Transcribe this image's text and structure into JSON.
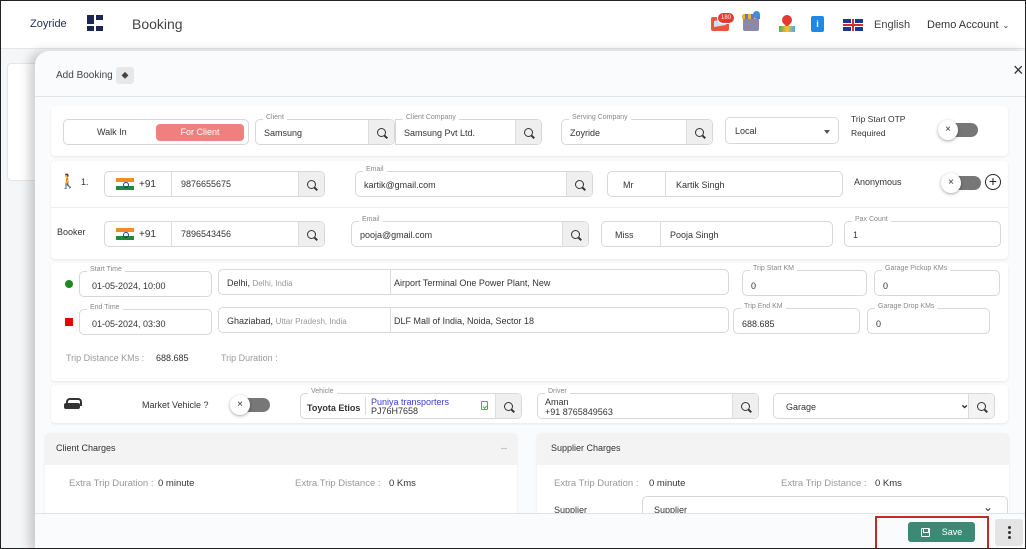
{
  "topbar": {
    "brand": "Zoyride",
    "page_title": "Booking",
    "notification_count": "180",
    "info_glyph": "i",
    "language": "English",
    "account": "Demo Account",
    "chevron": "⌄"
  },
  "modal": {
    "title": "Add Booking",
    "tag_icon": "⬥",
    "close_glyph": "×"
  },
  "booking_type": {
    "options": [
      "Walk In",
      "For Client"
    ],
    "selected": "For Client",
    "client_label": "Client",
    "client_value": "Samsung",
    "client_company_label": "Client Company",
    "client_company_value": "Samsung Pvt Ltd.",
    "serving_company_label": "Serving Company",
    "serving_company_value": "Zoyride",
    "trip_type": "Local",
    "otp_label_1": "Trip Start OTP",
    "otp_label_2": "Required",
    "otp_toggle_glyph": "×"
  },
  "passenger": {
    "index": "1.",
    "country_code": "+91",
    "phone": "9876655675",
    "email_label": "Email",
    "email": "kartik@gmail.com",
    "salutation": "Mr",
    "name": "Kartik Singh",
    "anonymous_label": "Anonymous",
    "toggle_glyph": "×",
    "add_glyph": "+"
  },
  "booker": {
    "label": "Booker",
    "country_code": "+91",
    "phone": "7896543456",
    "email_label": "Email",
    "email": "pooja@gmail.com",
    "salutation": "Miss",
    "name": "Pooja Singh",
    "pax_label": "Pax Count",
    "pax": "1"
  },
  "trip": {
    "start_time_label": "Start Time",
    "start_time": "01-05-2024, 10:00",
    "start_city": "Delhi,",
    "start_region": "Delhi, India",
    "start_address": "Airport Terminal One Power Plant, New",
    "trip_start_km_label": "Trip Start KM",
    "trip_start_km": "0",
    "garage_pickup_label": "Garage Pickup KMs",
    "garage_pickup": "0",
    "end_time_label": "End Time",
    "end_time": "01-05-2024, 03:30",
    "end_city": "Ghaziabad,",
    "end_region": "Uttar Pradesh, India",
    "end_address": "DLF Mall of India, Noida, Sector 18",
    "trip_end_km_label": "Trip End KM",
    "trip_end_km": "688.685",
    "garage_drop_label": "Garage Drop KMs",
    "garage_drop": "0",
    "distance_label": "Trip Distance KMs :",
    "distance": "688.685",
    "duration_label": "Trip Duration :",
    "duration": ""
  },
  "vehicle": {
    "market_label": "Market Vehicle ?",
    "toggle_glyph": "×",
    "vehicle_label": "Vehicle",
    "vehicle_model": "Toyota Etios",
    "transporter": "Puniya transporters",
    "plate": "PJ76H7658",
    "driver_label": "Driver",
    "driver_name": "Aman",
    "driver_phone": "+91 8765849563",
    "garage_placeholder": "Garage",
    "garage_chevron": "⌄"
  },
  "client_charges": {
    "title": "Client Charges",
    "collapse": "--",
    "extra_duration_label": "Extra Trip Duration :",
    "extra_duration": "0 minute",
    "extra_distance_label": "Extra Trip Distance :",
    "extra_distance": "0 Kms"
  },
  "supplier_charges": {
    "title": "Supplier Charges",
    "extra_duration_label": "Extra Trip Duration :",
    "extra_duration": "0 minute",
    "extra_distance_label": "Extra Trip Distance :",
    "extra_distance": "0 Kms",
    "supplier_label": "Supplier",
    "supplier_placeholder": "Supplier",
    "chevron": "⌄"
  },
  "footer": {
    "save_label": "Save"
  },
  "colors": {
    "accent_pink": "#f08080",
    "save_green": "#3d8a74",
    "highlight_red": "#c62828",
    "transporter_blue": "#3b3bd6"
  }
}
